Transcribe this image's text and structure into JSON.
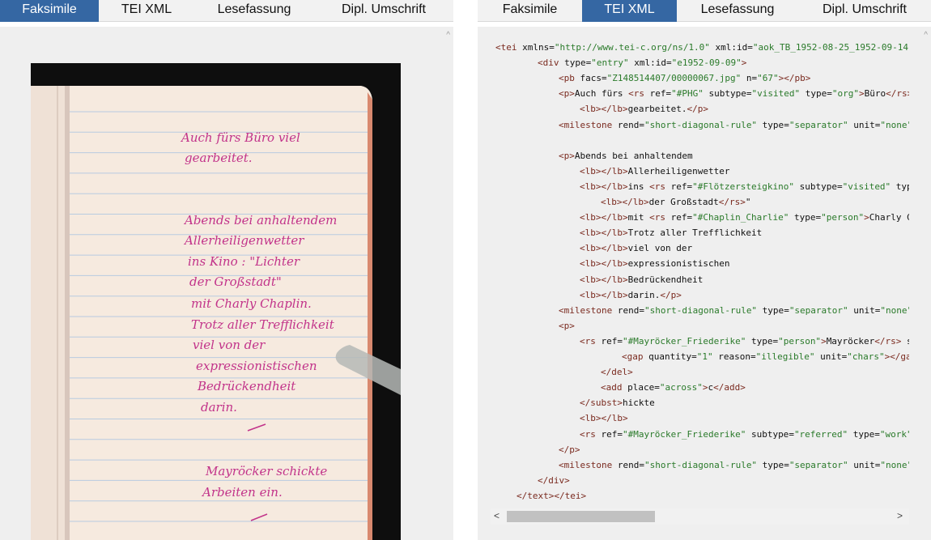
{
  "left": {
    "tabs": [
      {
        "label": "Faksimile",
        "active": true
      },
      {
        "label": "TEI XML",
        "active": false
      },
      {
        "label": "Lesefassung",
        "active": false
      },
      {
        "label": "Dipl. Umschrift",
        "active": false
      }
    ],
    "handwriting": [
      "Auch fürs Büro viel",
      "gearbeitet.",
      "Abends bei anhaltendem",
      "Allerheiligenwetter",
      "ins Kino : \"Lichter",
      "der Großstadt\"",
      "mit Charly Chaplin.",
      "Trotz aller Trefflichkeit",
      "viel von der",
      "expressionistischen",
      "Bedrückendheit",
      "darin.",
      "Mayröcker schickte",
      "Arbeiten ein."
    ]
  },
  "right": {
    "tabs": [
      {
        "label": "Faksimile",
        "active": false
      },
      {
        "label": "TEI XML",
        "active": true
      },
      {
        "label": "Lesefassung",
        "active": false
      },
      {
        "label": "Dipl. Umschrift",
        "active": false
      }
    ],
    "xml_lines": [
      "<tei xmlns=\"http://www.tei-c.org/ns/1.0\" xml:id=\"aok_TB_1952-08-25_1952-09-14\"",
      "<div type=\"entry\" xml:id=\"e1952-09-09\">",
      "<pb facs=\"Z148514407/00000067.jpg\" n=\"67\"></pb>",
      "<p>Auch fürs <rs ref=\"#PHG\" subtype=\"visited\" type=\"org\">Büro</rs>",
      "<lb></lb>gearbeitet.</p>",
      "<milestone rend=\"short-diagonal-rule\" type=\"separator\" unit=\"none\"",
      "",
      "<p>Abends bei anhaltendem",
      "<lb></lb>Allerheiligenwetter",
      "<lb></lb>ins <rs ref=\"#Flötzersteigkino\" subtype=\"visited\" typ",
      "<lb></lb>der Großstadt</rs>\"",
      "<lb></lb>mit <rs ref=\"#Chaplin_Charlie\" type=\"person\">Charly C",
      "<lb></lb>Trotz aller Trefflichkeit",
      "<lb></lb>viel von der",
      "<lb></lb>expressionistischen",
      "<lb></lb>Bedrückendheit",
      "<lb></lb>darin.</p>",
      "<milestone rend=\"short-diagonal-rule\" type=\"separator\" unit=\"none\"",
      "<p>",
      "<rs ref=\"#Mayröcker_Friederike\" type=\"person\">Mayröcker</rs> s",
      "<gap quantity=\"1\" reason=\"illegible\" unit=\"chars\"></ga",
      "</del>",
      "<add place=\"across\">c</add>",
      "</subst>hickte",
      "<lb></lb>",
      "<rs ref=\"#Mayröcker_Friederike\" subtype=\"referred\" type=\"work\"",
      "</p>",
      "<milestone rend=\"short-diagonal-rule\" type=\"separator\" unit=\"none\"",
      "</div>",
      "</text></tei>"
    ]
  },
  "colors": {
    "tab_active": "#3567a3",
    "ink": "#c2338a",
    "tag": "#7a2a1f",
    "value": "#2a7a2a"
  }
}
